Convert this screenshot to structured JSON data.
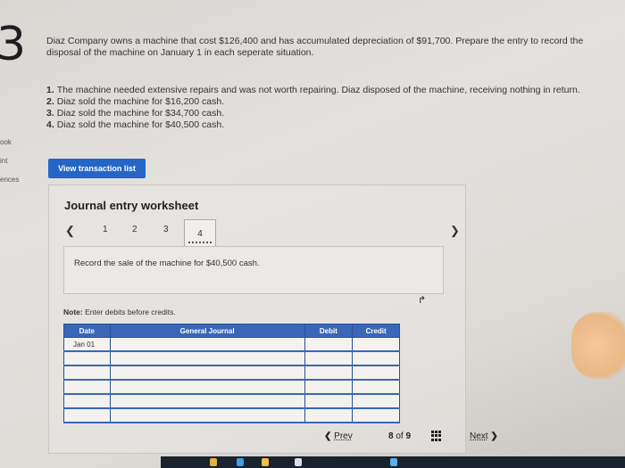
{
  "question": {
    "number": "3",
    "prompt": "Diaz Company owns a machine that cost $126,400 and has accumulated depreciation of $91,700. Prepare the entry to record the disposal of the machine on January 1 in each seperate situation.",
    "situations": [
      {
        "num": "1.",
        "text": "The machine needed extensive repairs and was not worth repairing. Diaz disposed of the machine, receiving nothing in return."
      },
      {
        "num": "2.",
        "text": "Diaz sold the machine for $16,200 cash."
      },
      {
        "num": "3.",
        "text": "Diaz sold the machine for $34,700 cash."
      },
      {
        "num": "4.",
        "text": "Diaz sold the machine for $40,500 cash."
      }
    ]
  },
  "sidebar_fragments": [
    "ook",
    "int",
    "ences"
  ],
  "view_transaction_button": "View transaction list",
  "worksheet": {
    "title": "Journal entry worksheet",
    "steps": [
      "1",
      "2",
      "3",
      "4"
    ],
    "active_step": "4",
    "instruction": "Record the sale of the machine for $40,500 cash.",
    "note_label": "Note:",
    "note_text": "Enter debits before credits.",
    "table": {
      "headers": [
        "Date",
        "General Journal",
        "Debit",
        "Credit"
      ],
      "rows": [
        {
          "date": "Jan 01",
          "account": "",
          "debit": "",
          "credit": ""
        },
        {
          "date": "",
          "account": "",
          "debit": "",
          "credit": ""
        },
        {
          "date": "",
          "account": "",
          "debit": "",
          "credit": ""
        },
        {
          "date": "",
          "account": "",
          "debit": "",
          "credit": ""
        },
        {
          "date": "",
          "account": "",
          "debit": "",
          "credit": ""
        },
        {
          "date": "",
          "account": "",
          "debit": "",
          "credit": ""
        }
      ]
    }
  },
  "pager": {
    "prev": "Prev",
    "current": "8",
    "of": "of",
    "total": "9",
    "next": "Next"
  }
}
